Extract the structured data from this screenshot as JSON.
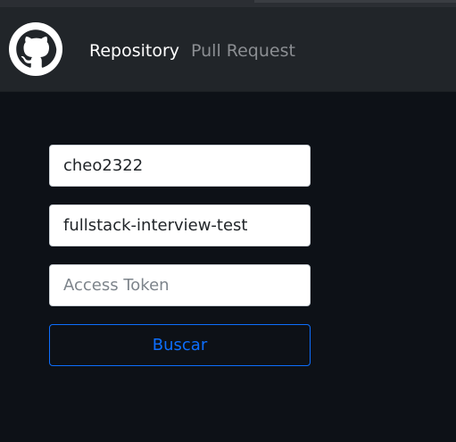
{
  "navbar": {
    "logo_icon": "github-icon",
    "links": [
      {
        "label": "Repository",
        "active": true
      },
      {
        "label": "Pull Request",
        "active": false
      }
    ]
  },
  "form": {
    "owner": {
      "value": "cheo2322"
    },
    "repo": {
      "value": "fullstack-interview-test"
    },
    "token": {
      "value": "",
      "placeholder": "Access Token"
    },
    "submit_label": "Buscar"
  },
  "colors": {
    "background": "#0d1117",
    "navbar": "#212529",
    "accent": "#0d6efd",
    "nav_active": "#ffffff",
    "nav_inactive": "#8b8e92"
  }
}
